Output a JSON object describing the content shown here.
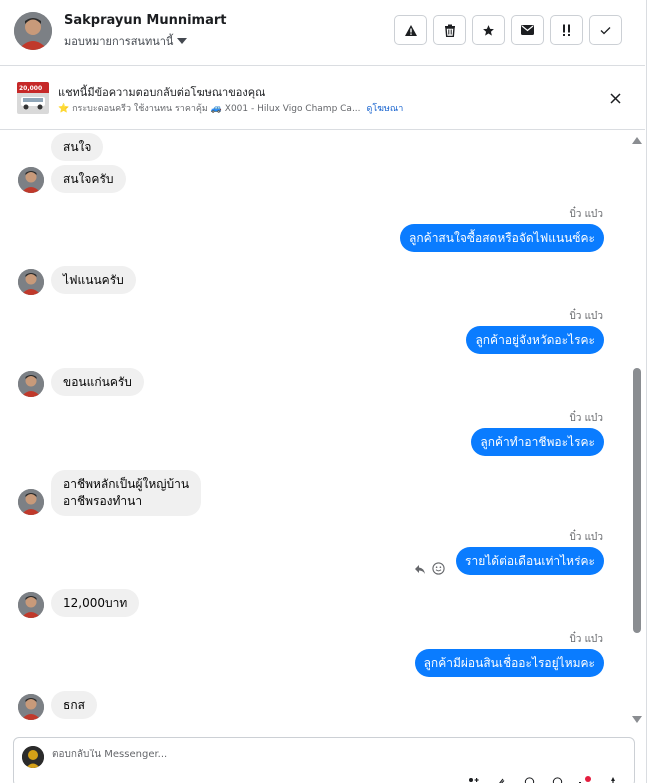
{
  "header": {
    "contact_name": "Sakprayun Munnimart",
    "assign_label": "มอบหมายการสนทนานี้"
  },
  "actions": [
    {
      "name": "report-button",
      "icon": "warning-icon"
    },
    {
      "name": "delete-button",
      "icon": "trash-icon"
    },
    {
      "name": "star-button",
      "icon": "star-icon"
    },
    {
      "name": "mark-unread-button",
      "icon": "envelope-icon"
    },
    {
      "name": "follow-up-button",
      "icon": "double-exclamation-icon"
    },
    {
      "name": "mark-done-button",
      "icon": "check-icon"
    }
  ],
  "ad": {
    "title": "แชทนี้มีข้อความตอบกลับต่อโฆษณาของคุณ",
    "thumb_label": "20,000",
    "subtitle": "⭐ กระบะดอนครีว ใช้งานทน ราคาคุ้ม 🚙 X001 - Hilux Vigo Champ Ca...",
    "link": "ดูโฆษณา"
  },
  "messages": {
    "m1": "สนใจ",
    "m2": "สนใจครับ",
    "s3": "บิ๋ว แบ๋ว",
    "m3": "ลูกค้าสนใจซื้อสดหรือจัดไฟแนนซ์คะ",
    "m4": "ไฟแนนครับ",
    "s5": "บิ๋ว แบ๋ว",
    "m5": "ลูกค้าอยู่จังหวัดอะไรคะ",
    "m6": "ขอนแก่นครับ",
    "s7": "บิ๋ว แบ๋ว",
    "m7": "ลูกค้าทำอาชีพอะไรคะ",
    "m8_line1": "อาชีพหลักเป็นผู้ใหญ่บ้าน",
    "m8_line2": "อาชีพรองทำนา",
    "s9": "บิ๋ว แบ๋ว",
    "m9": "รายได้ต่อเดือนเท่าไหร่คะ",
    "m10": "12,000บาท",
    "s11": "บิ๋ว แบ๋ว",
    "m11": "ลูกค้ามีผ่อนสินเชื่ออะไรอยู่ไหมคะ",
    "m12": "ธกส"
  },
  "composer": {
    "placeholder": "ตอบกลับใน Messenger..."
  },
  "colors": {
    "outgoing_bubble": "#0a7cff",
    "incoming_bubble": "#f0f0f0",
    "link": "#1763cf"
  }
}
